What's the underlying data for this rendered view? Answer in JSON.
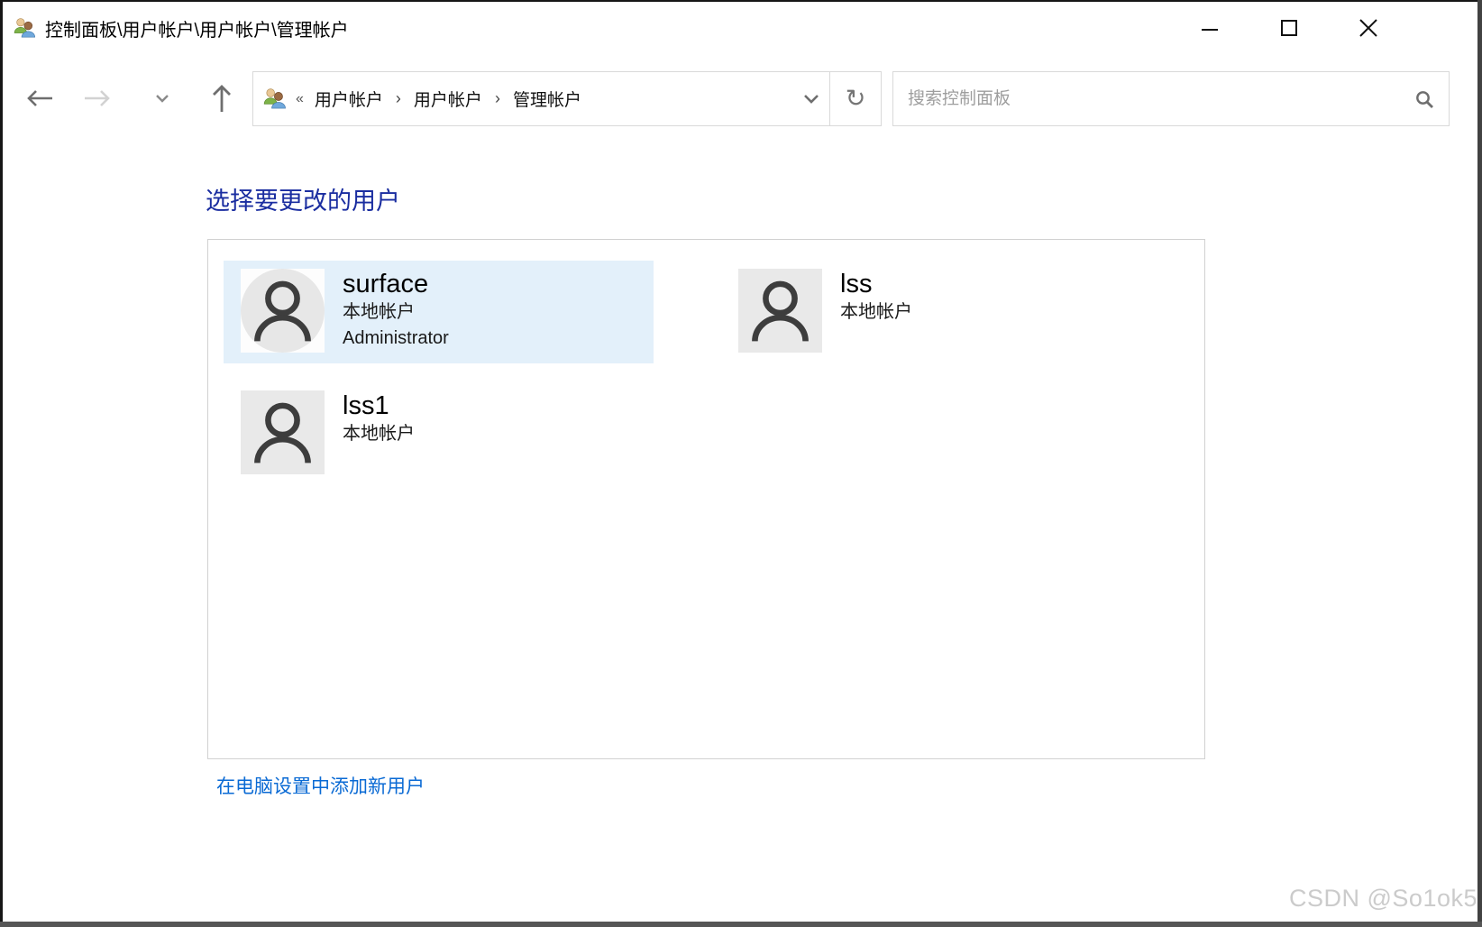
{
  "window": {
    "title": "控制面板\\用户帐户\\用户帐户\\管理帐户",
    "app_icon": "two-people-icon",
    "controls": {
      "minimize": "minimize",
      "maximize": "maximize",
      "close": "close"
    }
  },
  "toolbar": {
    "nav_icons": [
      "back-arrow",
      "forward-arrow",
      "recent-locations-chevron",
      "up-arrow"
    ],
    "breadcrumb": {
      "icon": "two-people-icon",
      "overflow_glyph": "«",
      "items": [
        "用户帐户",
        "用户帐户",
        "管理帐户"
      ],
      "separator": "›",
      "dropdown_icon": "chevron-down-icon",
      "refresh_glyph": "↻"
    },
    "search": {
      "placeholder": "搜索控制面板",
      "icon": "magnifier-icon"
    }
  },
  "main": {
    "heading": "选择要更改的用户",
    "users": [
      {
        "name": "surface",
        "details": [
          "本地帐户",
          "Administrator"
        ],
        "selected": true
      },
      {
        "name": "lss",
        "details": [
          "本地帐户"
        ],
        "selected": false
      },
      {
        "name": "lss1",
        "details": [
          "本地帐户"
        ],
        "selected": false
      }
    ],
    "add_user_link": "在电脑设置中添加新用户"
  },
  "watermark": "CSDN @So1ok5",
  "colors": {
    "heading_blue": "#1a2da0",
    "link_blue": "#0a6ad4",
    "selected_tile_bg": "#e3f0fa",
    "avatar_gray": "#e9e9e9",
    "border_gray": "#d9d9d9"
  }
}
